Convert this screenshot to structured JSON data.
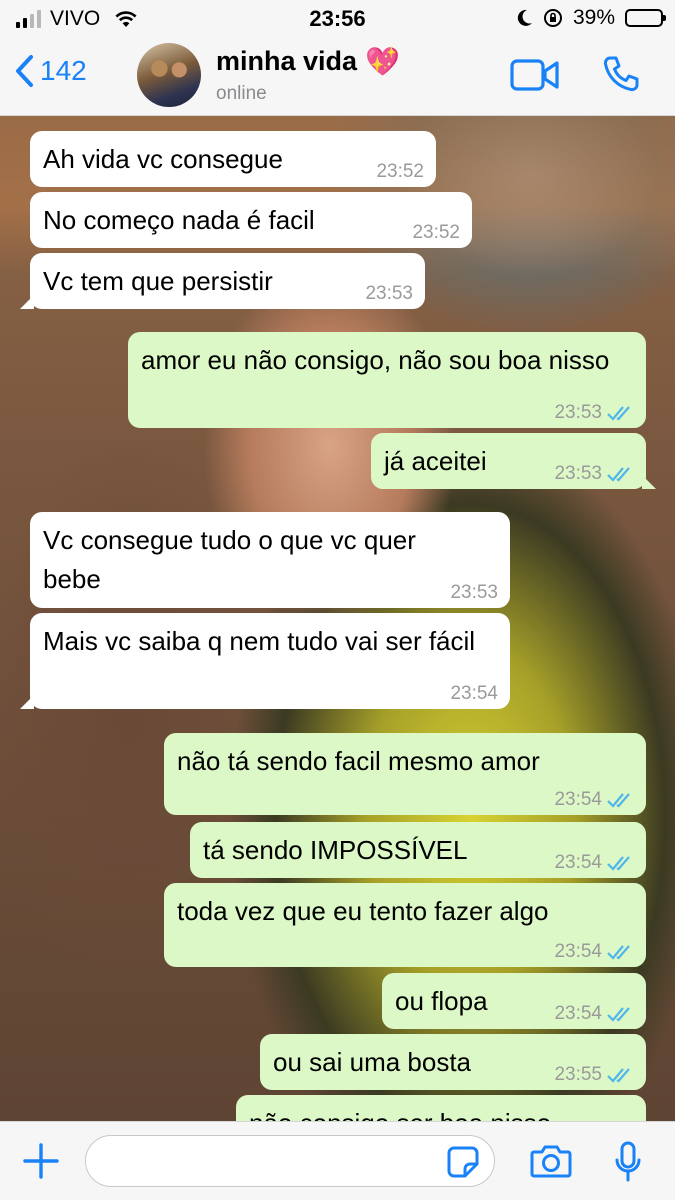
{
  "status_bar": {
    "carrier": "VIVO",
    "time": "23:56",
    "battery_percent": "39%",
    "battery_level": 0.39
  },
  "header": {
    "back_count": "142",
    "contact_name": "minha vida",
    "contact_status": "online",
    "icons": {
      "back": "chevron-left-icon",
      "video": "video-camera-icon",
      "call": "phone-icon",
      "name_emoji": "sparkling-heart-icon"
    }
  },
  "messages": [
    {
      "side": "in",
      "text": "Ah vida vc consegue",
      "time": "23:52"
    },
    {
      "side": "in",
      "text": "No começo nada é facil",
      "time": "23:52"
    },
    {
      "side": "in",
      "text": "Vc tem que persistir",
      "time": "23:53"
    },
    {
      "side": "out",
      "text": "amor eu não consigo, não sou boa nisso",
      "time": "23:53",
      "status": "read"
    },
    {
      "side": "out",
      "text": "já aceitei",
      "time": "23:53",
      "status": "read"
    },
    {
      "side": "in",
      "text": "Vc consegue tudo o que vc quer bebe",
      "time": "23:53"
    },
    {
      "side": "in",
      "text": "Mais vc saiba q nem tudo vai ser fácil",
      "time": "23:54"
    },
    {
      "side": "out",
      "text": "não tá sendo facil mesmo amor",
      "time": "23:54",
      "status": "read"
    },
    {
      "side": "out",
      "text": "tá sendo IMPOSSÍVEL",
      "time": "23:54",
      "status": "read"
    },
    {
      "side": "out",
      "text": "toda vez que eu tento fazer algo",
      "time": "23:54",
      "status": "read"
    },
    {
      "side": "out",
      "text": "ou flopa",
      "time": "23:54",
      "status": "read"
    },
    {
      "side": "out",
      "text": "ou sai uma bosta",
      "time": "23:55",
      "status": "read"
    },
    {
      "side": "out",
      "text": "não consigo ser boa nisso",
      "time": "",
      "status": "read"
    }
  ],
  "input_bar": {
    "placeholder": "",
    "icons": [
      "plus-icon",
      "sticker-icon",
      "camera-icon",
      "microphone-icon"
    ]
  },
  "colors": {
    "accent": "#1a82f7",
    "incoming_bubble": "#ffffff",
    "outgoing_bubble": "#dcf8c6",
    "read_ticks": "#4fb6ec"
  }
}
